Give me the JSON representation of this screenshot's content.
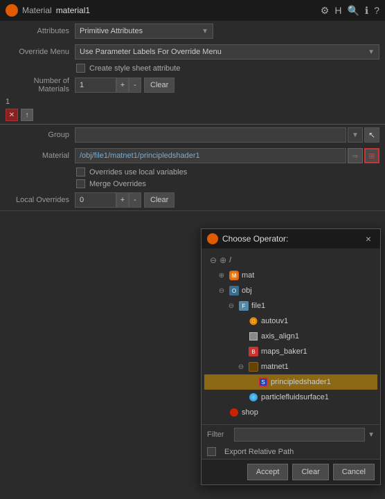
{
  "titleBar": {
    "iconLabel": "M",
    "typeLabel": "Material",
    "nameLabel": "material1",
    "icons": [
      "⚙",
      "H",
      "🔍",
      "ℹ",
      "?"
    ]
  },
  "form": {
    "attributesLabel": "Attributes",
    "attributesValue": "Primitive Attributes",
    "overrideMenuLabel": "Override Menu",
    "overrideMenuValue": "Use Parameter Labels For Override Menu",
    "createStyleSheet": "Create style sheet attribute",
    "numberOfMaterialsLabel": "Number of Materials",
    "numberOfMaterialsValue": "1",
    "clearLabel1": "Clear",
    "incrementLabel": "+",
    "decrementLabel": "-",
    "groupLabel": "Group",
    "materialLabel": "Material",
    "materialValue": "/obj/file1/matnet1/principledshader1",
    "overridesUseLocalLabel": "Overrides use local variables",
    "mergeOverridesLabel": "Merge Overrides",
    "localOverridesLabel": "Local Overrides",
    "localOverridesValue": "0",
    "clearLabel2": "Clear",
    "plusLabel": "+",
    "minusLabel": "-"
  },
  "modal": {
    "title": "Choose Operator:",
    "closeLabel": "×",
    "tree": [
      {
        "indent": 0,
        "label": "/",
        "iconType": "minus",
        "expanded": true,
        "isRoot": true
      },
      {
        "indent": 1,
        "label": "mat",
        "iconType": "orange-circle",
        "expanded": true
      },
      {
        "indent": 1,
        "label": "obj",
        "iconType": "folder",
        "expanded": true
      },
      {
        "indent": 2,
        "label": "file1",
        "iconType": "folder-blue",
        "expanded": true
      },
      {
        "indent": 3,
        "label": "autouv1",
        "iconType": "gear-orange"
      },
      {
        "indent": 3,
        "label": "axis_align1",
        "iconType": "box-white"
      },
      {
        "indent": 3,
        "label": "maps_baker1",
        "iconType": "map-red"
      },
      {
        "indent": 3,
        "label": "matnet1",
        "iconType": "folder-complex",
        "expanded": true
      },
      {
        "indent": 4,
        "label": "principledshader1",
        "iconType": "shader-blue",
        "selected": true
      },
      {
        "indent": 3,
        "label": "particlefluidsurface1",
        "iconType": "particle-green"
      },
      {
        "indent": 1,
        "label": "shop",
        "iconType": "shop-purple"
      }
    ],
    "filterLabel": "Filter",
    "filterValue": "",
    "exportRelativePath": "Export Relative Path",
    "acceptLabel": "Accept",
    "clearLabel": "Clear",
    "cancelLabel": "Cancel"
  }
}
